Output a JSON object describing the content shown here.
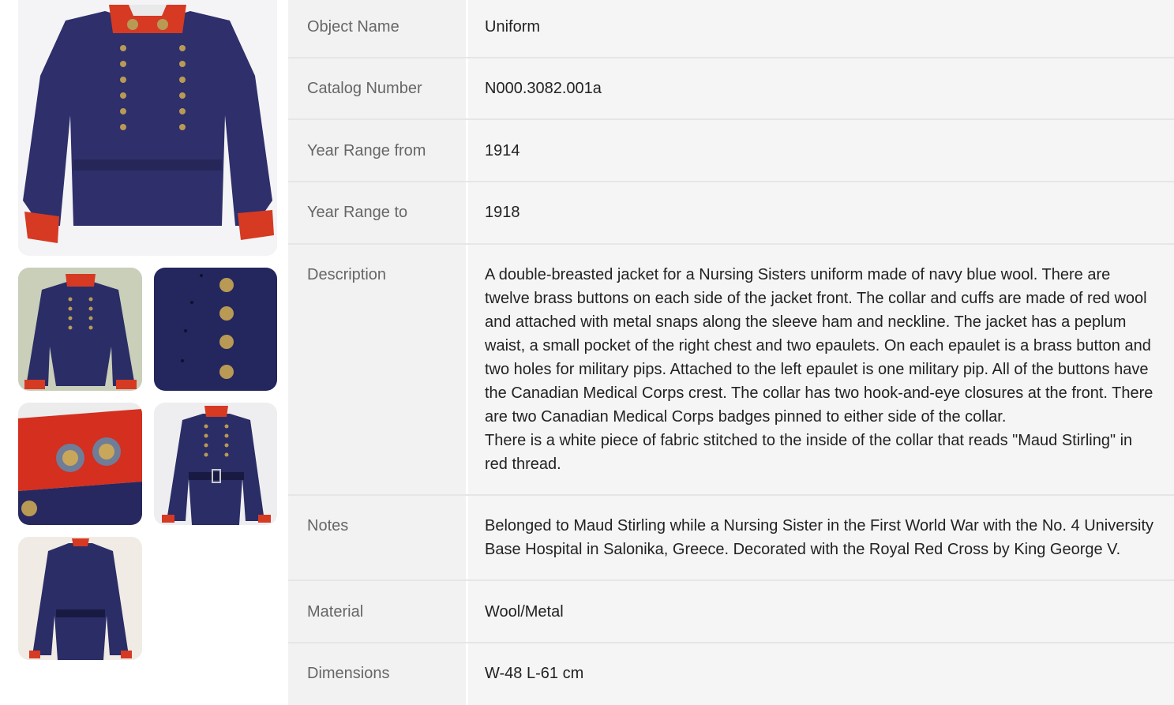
{
  "record": {
    "rows": [
      {
        "label": "Object Name",
        "value": "Uniform"
      },
      {
        "label": "Catalog Number",
        "value": "N000.3082.001a"
      },
      {
        "label": "Year Range from",
        "value": "1914"
      },
      {
        "label": "Year Range to",
        "value": "1918"
      },
      {
        "label": "Description",
        "value": "A double-breasted jacket for a Nursing Sisters uniform made of navy blue wool. There are twelve brass buttons on each side of the jacket front. The collar and cuffs are made of red wool and attached with metal snaps along the sleeve ham and neckline. The jacket has a peplum waist, a small pocket of the right chest and two epaulets. On each epaulet is a brass button and two holes for military pips. Attached to the left epaulet is one military pip. All of the buttons have the Canadian Medical Corps crest. The collar has two hook-and-eye closures at the front. There are two Canadian Medical Corps badges pinned to either side of the collar.",
        "value2": "There is a white piece of fabric stitched to the inside of the collar that reads \"Maud Stirling\" in red thread."
      },
      {
        "label": "Notes",
        "value": "Belonged to Maud Stirling while a Nursing Sister in the First World War with the No. 4 University Base Hospital in Salonika, Greece. Decorated with the Royal Red Cross by King George V."
      },
      {
        "label": "Material",
        "value": "Wool/Metal"
      },
      {
        "label": "Dimensions",
        "value": "W-48 L-61 cm"
      }
    ]
  },
  "colors": {
    "uniform_navy": "#2e2f6b",
    "collar_red": "#d63a23",
    "brass": "#b89a55"
  }
}
